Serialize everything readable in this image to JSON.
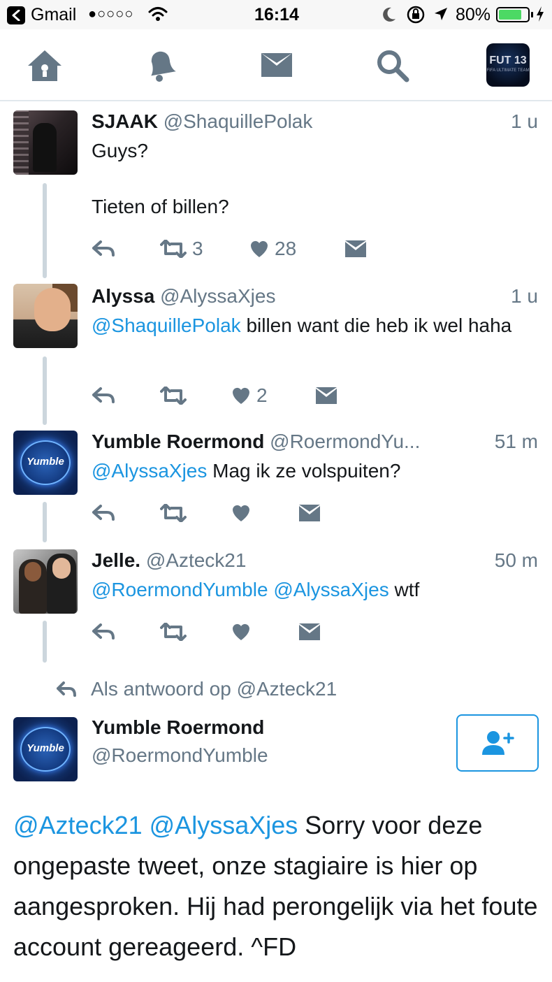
{
  "status_bar": {
    "app": "Gmail",
    "signal": "●○○○○",
    "time": "16:14",
    "battery_text": "80%",
    "battery_level": 0.8
  },
  "nav": {
    "icons": [
      "home-icon",
      "bell-icon",
      "mail-icon",
      "search-icon"
    ],
    "profile_avatar_text": "FUT 13",
    "profile_avatar_subtext": "FIFA ULTIMATE TEAM"
  },
  "tweets": [
    {
      "name": "SJAAK",
      "handle": "@ShaquillePolak",
      "time": "1 u",
      "line1": "Guys?",
      "line2": "Tieten of billen?",
      "retweets": "3",
      "likes": "28"
    },
    {
      "name": "Alyssa",
      "handle": "@AlyssaXjes",
      "time": "1 u",
      "mention": "@ShaquillePolak",
      "text": " billen want die heb ik wel haha",
      "retweets": "",
      "likes": "2"
    },
    {
      "name": "Yumble Roermond",
      "handle": "@RoermondYu...",
      "time": "51 m",
      "mention": "@AlyssaXjes",
      "text": " Mag ik ze volspuiten?",
      "avatar_text": "Yumble"
    },
    {
      "name": "Jelle.",
      "handle": "@Azteck21",
      "time": "50 m",
      "mention1": "@RoermondYumble",
      "mention2": "@AlyssaXjes",
      "text": " wtf"
    }
  ],
  "reply_context": "Als antwoord op @Azteck21",
  "main_tweet": {
    "name": "Yumble Roermond",
    "handle": "@RoermondYumble",
    "avatar_text": "Yumble",
    "mention1": "@Azteck21",
    "mention2": "@AlyssaXjes",
    "text": " Sorry voor deze ongepaste tweet, onze stagiaire is hier op aangesproken. Hij had perongelijk via het foute account gereageerd. ^FD"
  },
  "colors": {
    "link": "#1b95e0",
    "secondary_text": "#657786",
    "icon_gray": "#657786",
    "thread_line": "#ccd6dd",
    "battery_green": "#4cd964"
  }
}
